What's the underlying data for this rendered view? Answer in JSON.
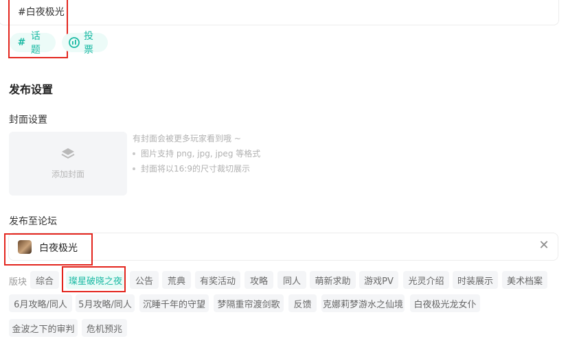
{
  "editor": {
    "topic_text": "#白夜极光"
  },
  "toolbar": {
    "topic_label": "话题",
    "vote_label": "投票"
  },
  "publish": {
    "section_title": "发布设置",
    "cover_label": "封面设置",
    "cover_button": "添加封面",
    "cover_hint": "有封面会被更多玩家看到哦 ~",
    "cover_rules": [
      "图片支持 png, jpg, jpeg 等格式",
      "封面将以16:9的尺寸裁切展示"
    ],
    "forum_label": "发布至论坛",
    "forum_name": "白夜极光"
  },
  "sections": {
    "label": "版块",
    "selected": "璨星破晓之夜",
    "items": [
      "综合",
      "璨星破晓之夜",
      "公告",
      "荒典",
      "有奖活动",
      "攻略",
      "同人",
      "萌新求助",
      "游戏PV",
      "光灵介绍",
      "时装展示",
      "美术档案",
      "6月攻略/同人",
      "5月攻略/同人",
      "沉睡千年的守望",
      "梦隔重帘渡剑歌",
      "反馈",
      "克娜莉梦游水之仙境",
      "白夜极光龙女仆",
      "金波之下的审判",
      "危机预兆"
    ]
  },
  "colors": {
    "accent": "#1ab9a3",
    "highlight_red": "#e3241c",
    "chip_bg": "#f4f5f7"
  }
}
